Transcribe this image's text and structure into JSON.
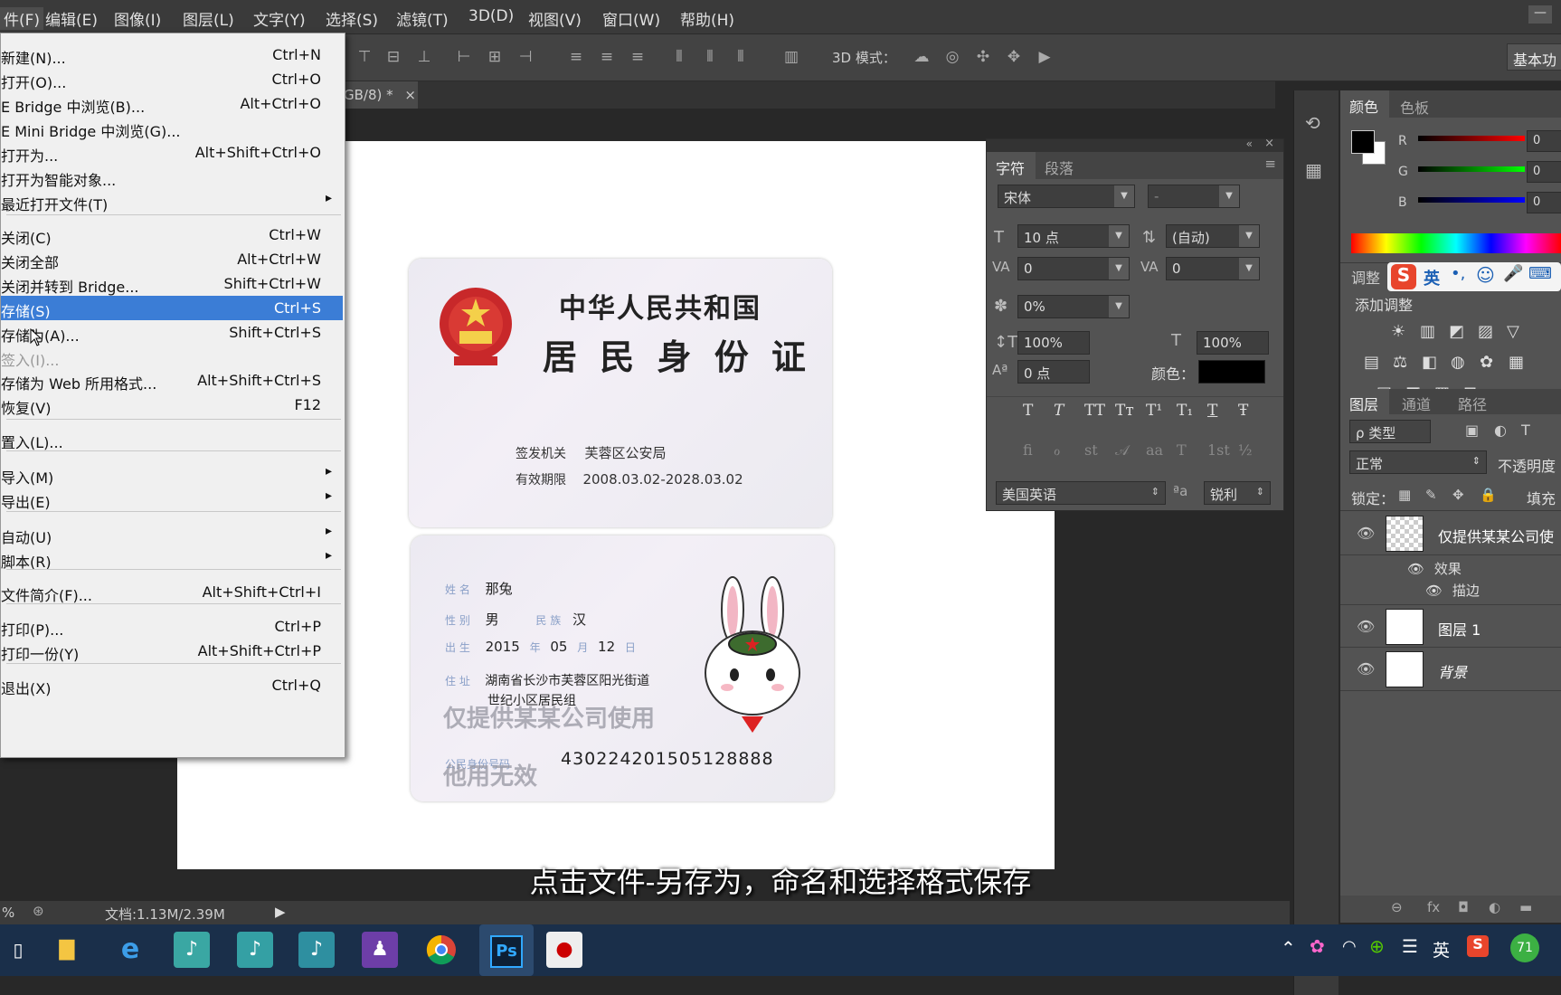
{
  "menubar": {
    "items": [
      "件(F)",
      "编辑(E)",
      "图像(I)",
      "图层(L)",
      "文字(Y)",
      "选择(S)",
      "滤镜(T)",
      "3D(D)",
      "视图(V)",
      "窗口(W)",
      "帮助(H)"
    ]
  },
  "options": {
    "mode_3d_label": "3D 模式：",
    "workspace_label": "基本功"
  },
  "document": {
    "tab_label": "GB/8) *",
    "tab_close": "×"
  },
  "idcard": {
    "front": {
      "title1": "中华人民共和国",
      "title2": "居 民 身 份 证",
      "authority_label": "签发机关",
      "authority_value": "芙蓉区公安局",
      "validity_label": "有效期限",
      "validity_value": "2008.03.02-2028.03.02"
    },
    "back": {
      "name_label": "姓 名",
      "name_value": "那兔",
      "sex_label": "性 别",
      "sex_value": "男",
      "ethnic_label": "民 族",
      "ethnic_value": "汉",
      "birth_label": "出 生",
      "birth_year": "2015",
      "birth_year_unit": "年",
      "birth_month": "05",
      "birth_month_unit": "月",
      "birth_day": "12",
      "birth_day_unit": "日",
      "address_label": "住 址",
      "address_line1": "湖南省长沙市芙蓉区阳光街道",
      "address_line2": "世纪小区居民组",
      "id_label": "公民身份号码",
      "id_number": "430224201505128888",
      "watermark1": "仅提供某某公司使用",
      "watermark2": "他用无效"
    }
  },
  "file_menu": {
    "items": [
      {
        "label": "新建(N)...",
        "shortcut": "Ctrl+N"
      },
      {
        "label": "打开(O)...",
        "shortcut": "Ctrl+O"
      },
      {
        "label": "E Bridge 中浏览(B)...",
        "shortcut": "Alt+Ctrl+O"
      },
      {
        "label": "E Mini Bridge 中浏览(G)...",
        "shortcut": ""
      },
      {
        "label": "打开为...",
        "shortcut": "Alt+Shift+Ctrl+O"
      },
      {
        "label": "打开为智能对象...",
        "shortcut": ""
      },
      {
        "label": "最近打开文件(T)",
        "shortcut": ""
      },
      {
        "label": "关闭(C)",
        "shortcut": "Ctrl+W"
      },
      {
        "label": "关闭全部",
        "shortcut": "Alt+Ctrl+W"
      },
      {
        "label": "关闭并转到 Bridge...",
        "shortcut": "Shift+Ctrl+W"
      },
      {
        "label": "存储(S)",
        "shortcut": "Ctrl+S"
      },
      {
        "label": "存储为(A)...",
        "shortcut": "Shift+Ctrl+S"
      },
      {
        "label": "签入(I)...",
        "shortcut": ""
      },
      {
        "label": "存储为 Web 所用格式...",
        "shortcut": "Alt+Shift+Ctrl+S"
      },
      {
        "label": "恢复(V)",
        "shortcut": "F12"
      },
      {
        "label": "置入(L)...",
        "shortcut": ""
      },
      {
        "label": "导入(M)",
        "shortcut": ""
      },
      {
        "label": "导出(E)",
        "shortcut": ""
      },
      {
        "label": "自动(U)",
        "shortcut": ""
      },
      {
        "label": "脚本(R)",
        "shortcut": ""
      },
      {
        "label": "文件简介(F)...",
        "shortcut": "Alt+Shift+Ctrl+I"
      },
      {
        "label": "打印(P)...",
        "shortcut": "Ctrl+P"
      },
      {
        "label": "打印一份(Y)",
        "shortcut": "Alt+Shift+Ctrl+P"
      },
      {
        "label": "退出(X)",
        "shortcut": "Ctrl+Q"
      }
    ]
  },
  "char_panel": {
    "tab_char": "字符",
    "tab_para": "段落",
    "font_family": "宋体",
    "font_style": "-",
    "font_size": "10 点",
    "leading": "(自动)",
    "kerning": "0",
    "tracking": "0",
    "scale_pct": "0%",
    "vscale": "100%",
    "hscale": "100%",
    "baseline": "0 点",
    "color_label": "颜色：",
    "style_buttons": [
      "T",
      "T",
      "TT",
      "Tт",
      "T¹",
      "T₁",
      "T",
      "Ŧ"
    ],
    "ot_buttons": [
      "fi",
      "ℴ",
      "st",
      "𝒜",
      "aa",
      "T",
      "1st",
      "½"
    ],
    "language": "美国英语",
    "aa_label": "a",
    "antialias": "锐利"
  },
  "color_panel": {
    "tab_color": "颜色",
    "tab_swatch": "色板",
    "r_label": "R",
    "g_label": "G",
    "b_label": "B",
    "r_value": "0",
    "g_value": "0",
    "b_value": "0"
  },
  "adjust_panel": {
    "tab": "调整",
    "ime_lang": "英",
    "add_label": "添加调整"
  },
  "layers_panel": {
    "tab_layers": "图层",
    "tab_channels": "通道",
    "tab_paths": "路径",
    "filter_kind": "ρ 类型",
    "blend_mode": "正常",
    "opacity_label": "不透明度",
    "lock_label": "锁定：",
    "fill_label": "填充",
    "layers": [
      {
        "name": "仅提供某某公司使"
      },
      {
        "name": "效果"
      },
      {
        "name": "描边"
      },
      {
        "name": "图层 1"
      },
      {
        "name": "背景"
      }
    ]
  },
  "status": {
    "zoom": "%",
    "doc_info": "文档:1.13M/2.39M"
  },
  "subtitle": "点击文件-另存为，命名和选择格式保存",
  "taskbar": {
    "ps_label": "Ps",
    "tray_lang": "英",
    "tray_badge": "71"
  }
}
